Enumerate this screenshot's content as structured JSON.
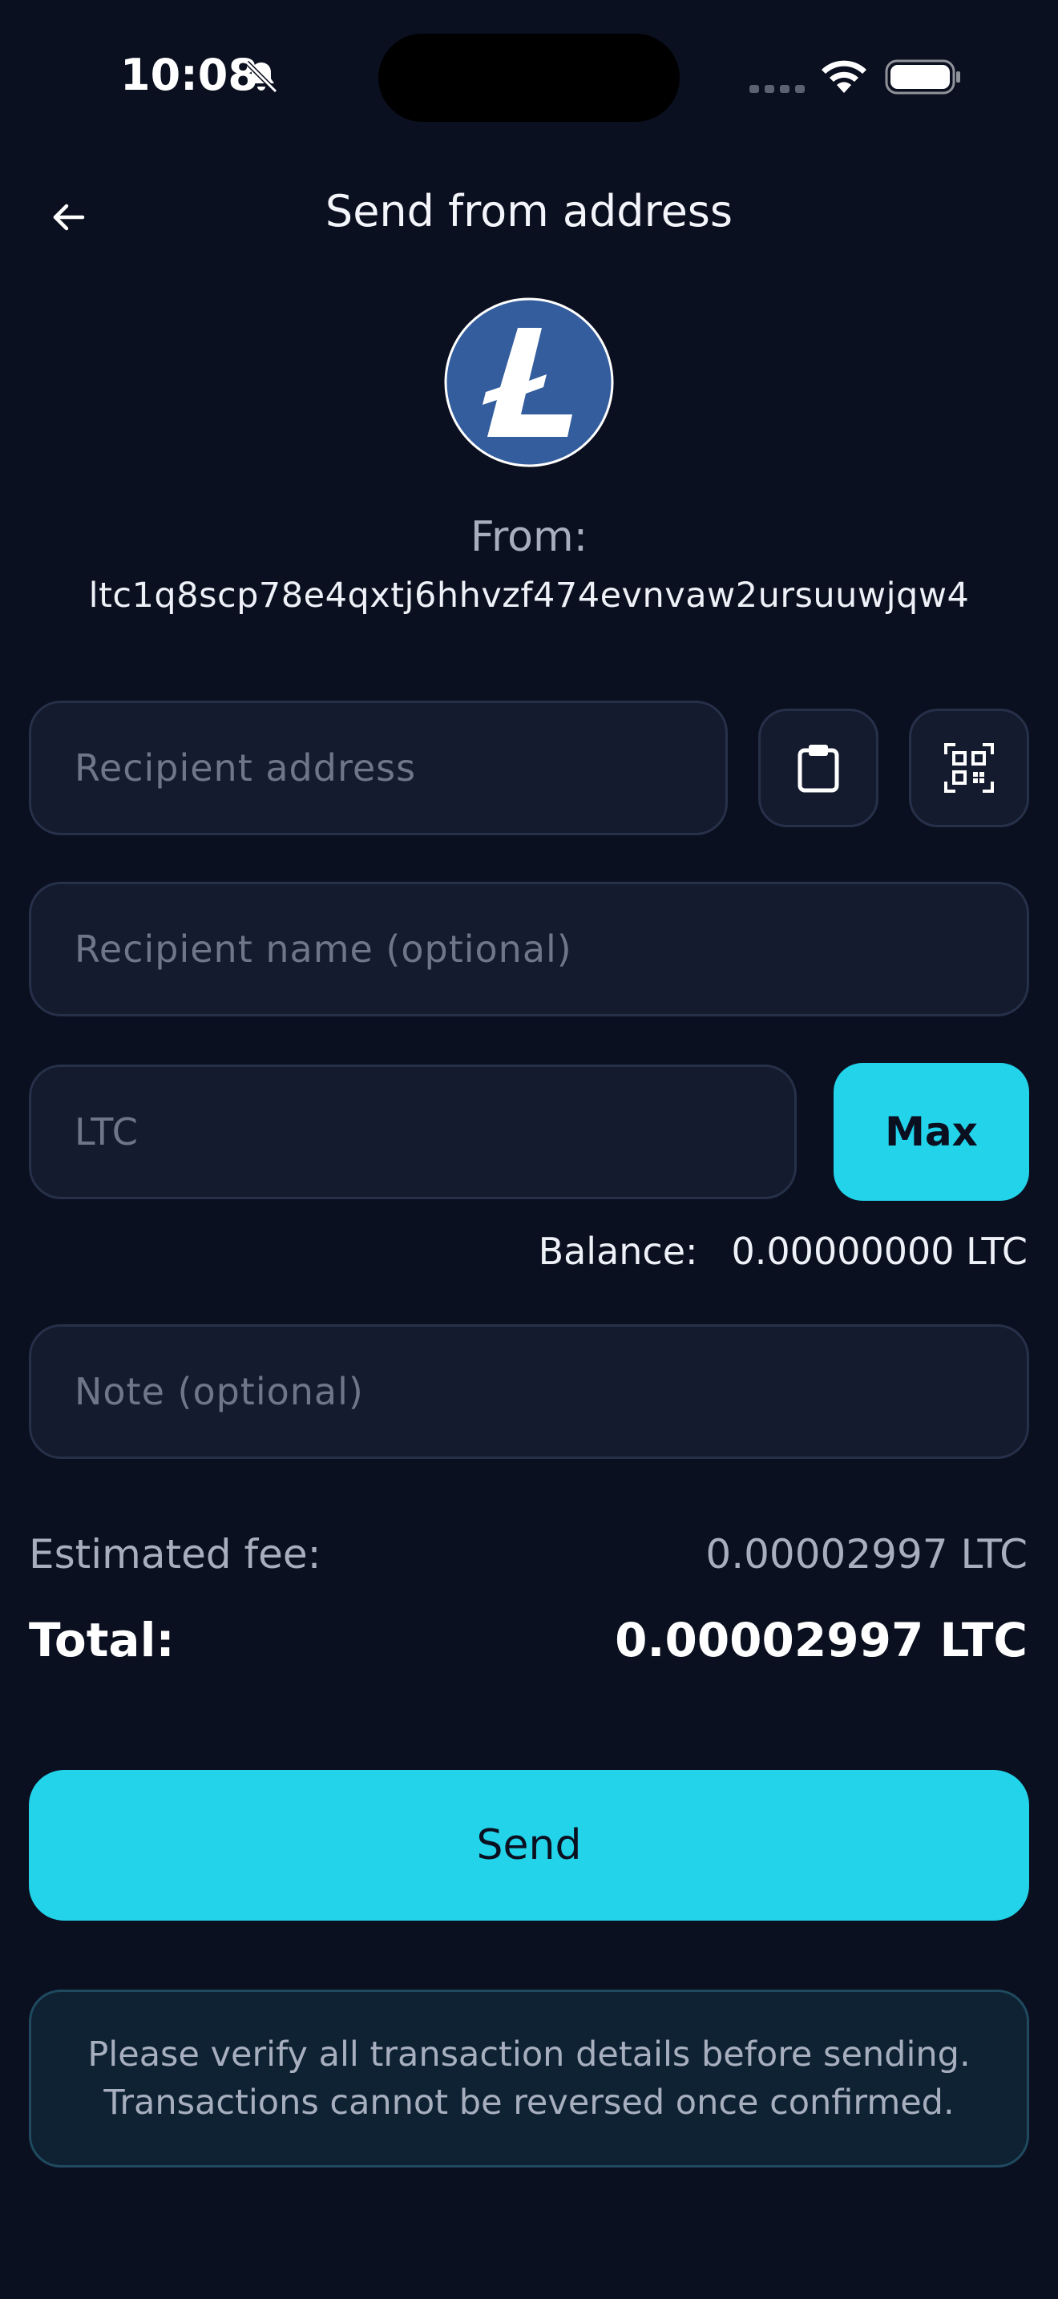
{
  "status_bar": {
    "time": "10:08"
  },
  "header": {
    "title": "Send from address",
    "back_icon": "arrow-left-icon"
  },
  "coin": {
    "icon": "litecoin-logo",
    "brand_color": "#345d9d"
  },
  "from": {
    "label": "From:",
    "address": "ltc1q8scp78e4qxtj6hhvzf474evnvaw2ursuuwjqw4"
  },
  "form": {
    "recipient_address_placeholder": "Recipient address",
    "recipient_address_value": "",
    "paste_icon": "clipboard-icon",
    "scan_icon": "qr-scan-icon",
    "recipient_name_placeholder": "Recipient name (optional)",
    "recipient_name_value": "",
    "amount_placeholder": "LTC",
    "amount_value": "",
    "max_label": "Max",
    "note_placeholder": "Note (optional)",
    "note_value": ""
  },
  "balance": {
    "label": "Balance:",
    "value": "0.00000000 LTC"
  },
  "summary": {
    "fee_label": "Estimated fee:",
    "fee_value": "0.00002997 LTC",
    "total_label": "Total:",
    "total_value": "0.00002997 LTC"
  },
  "send_label": "Send",
  "warning": {
    "line1": "Please verify all transaction details before sending.",
    "line2": "Transactions cannot be reversed once confirmed."
  },
  "colors": {
    "background": "#0b1020",
    "accent": "#22d3ea",
    "field_bg": "#141b2e",
    "field_border": "#263049"
  }
}
